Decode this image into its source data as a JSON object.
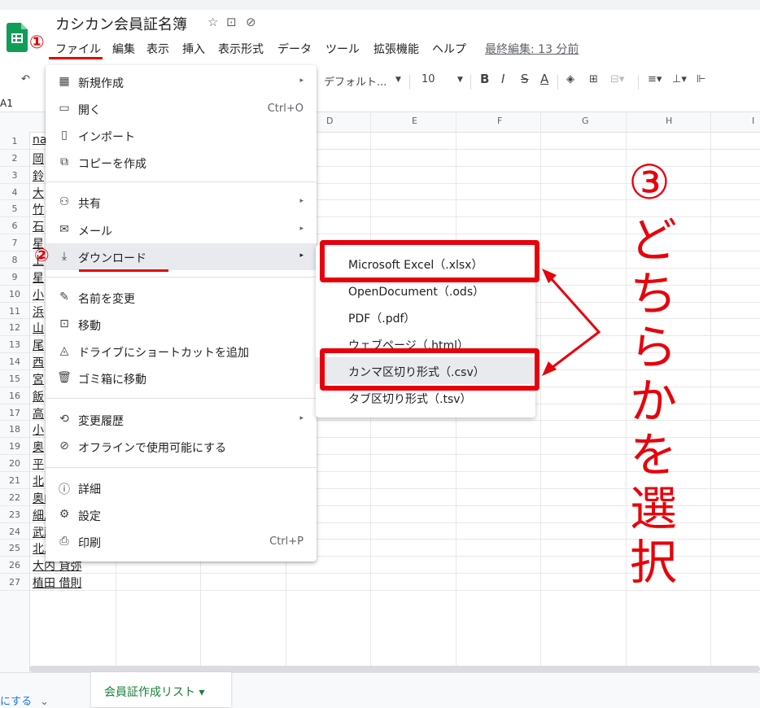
{
  "app": {
    "title": "カシカン会員証名簿",
    "title_icons": [
      "star-icon",
      "folder-move-icon",
      "cloud-status-icon"
    ]
  },
  "menubar": {
    "items": [
      "ファイル",
      "編集",
      "表示",
      "挿入",
      "表示形式",
      "データ",
      "ツール",
      "拡張機能",
      "ヘルプ"
    ],
    "last_edit": "最終編集: 13 分前"
  },
  "toolbar": {
    "font": "デフォルト...",
    "font_size": "10",
    "bold": "B",
    "italic": "I",
    "strike": "S",
    "text_color": "A"
  },
  "namebox": "A1",
  "columns": [
    "D",
    "E",
    "F",
    "G",
    "H",
    "I"
  ],
  "rows": [
    {
      "n": "1",
      "b": "na"
    },
    {
      "n": "2",
      "b": "岡"
    },
    {
      "n": "3",
      "b": "鈴"
    },
    {
      "n": "4",
      "b": "大"
    },
    {
      "n": "5",
      "b": "竹"
    },
    {
      "n": "6",
      "b": "石"
    },
    {
      "n": "7",
      "b": "星"
    },
    {
      "n": "8",
      "b": "上"
    },
    {
      "n": "9",
      "b": "星"
    },
    {
      "n": "10",
      "b": "小"
    },
    {
      "n": "11",
      "b": "浜"
    },
    {
      "n": "12",
      "b": "山"
    },
    {
      "n": "13",
      "b": "尾"
    },
    {
      "n": "14",
      "b": "西"
    },
    {
      "n": "15",
      "b": "宮"
    },
    {
      "n": "16",
      "b": "飯"
    },
    {
      "n": "17",
      "b": "高"
    },
    {
      "n": "18",
      "b": "小"
    },
    {
      "n": "19",
      "b": "奥"
    },
    {
      "n": "20",
      "b": "平"
    },
    {
      "n": "21",
      "b": "北"
    },
    {
      "n": "22",
      "b": "奥山 貸香"
    },
    {
      "n": "23",
      "b": "細川 借士"
    },
    {
      "n": "24",
      "b": "武藤 貸江"
    },
    {
      "n": "25",
      "b": "北島 借保子"
    },
    {
      "n": "26",
      "b": "大内 貸弥"
    },
    {
      "n": "27",
      "b": "植田 借則"
    }
  ],
  "file_menu": {
    "new": "新規作成",
    "open": "開く",
    "open_shortcut": "Ctrl+O",
    "import": "インポート",
    "copy": "コピーを作成",
    "share": "共有",
    "email": "メール",
    "download": "ダウンロード",
    "rename": "名前を変更",
    "move": "移動",
    "shortcut": "ドライブにショートカットを追加",
    "trash": "ゴミ箱に移動",
    "history": "変更履歴",
    "offline": "オフラインで使用可能にする",
    "details": "詳細",
    "settings": "設定",
    "print": "印刷",
    "print_shortcut": "Ctrl+P"
  },
  "download_submenu": {
    "xlsx": "Microsoft Excel（.xlsx）",
    "ods": "OpenDocument（.ods）",
    "pdf": "PDF（.pdf）",
    "html": "ウェブページ（.html）",
    "csv": "カンマ区切り形式（.csv）",
    "tsv": "タブ区切り形式（.tsv）"
  },
  "sheet_tab": "会員証作成リスト ▾",
  "bottom_left": "にする",
  "annotations": {
    "step1": "①",
    "step2": "②",
    "step3": "③",
    "instruction": [
      "ど",
      "ち",
      "ら",
      "か",
      "を",
      "選",
      "択"
    ]
  },
  "colors": {
    "accent_red": "#e8000b",
    "sheets_green": "#0f9d58"
  }
}
